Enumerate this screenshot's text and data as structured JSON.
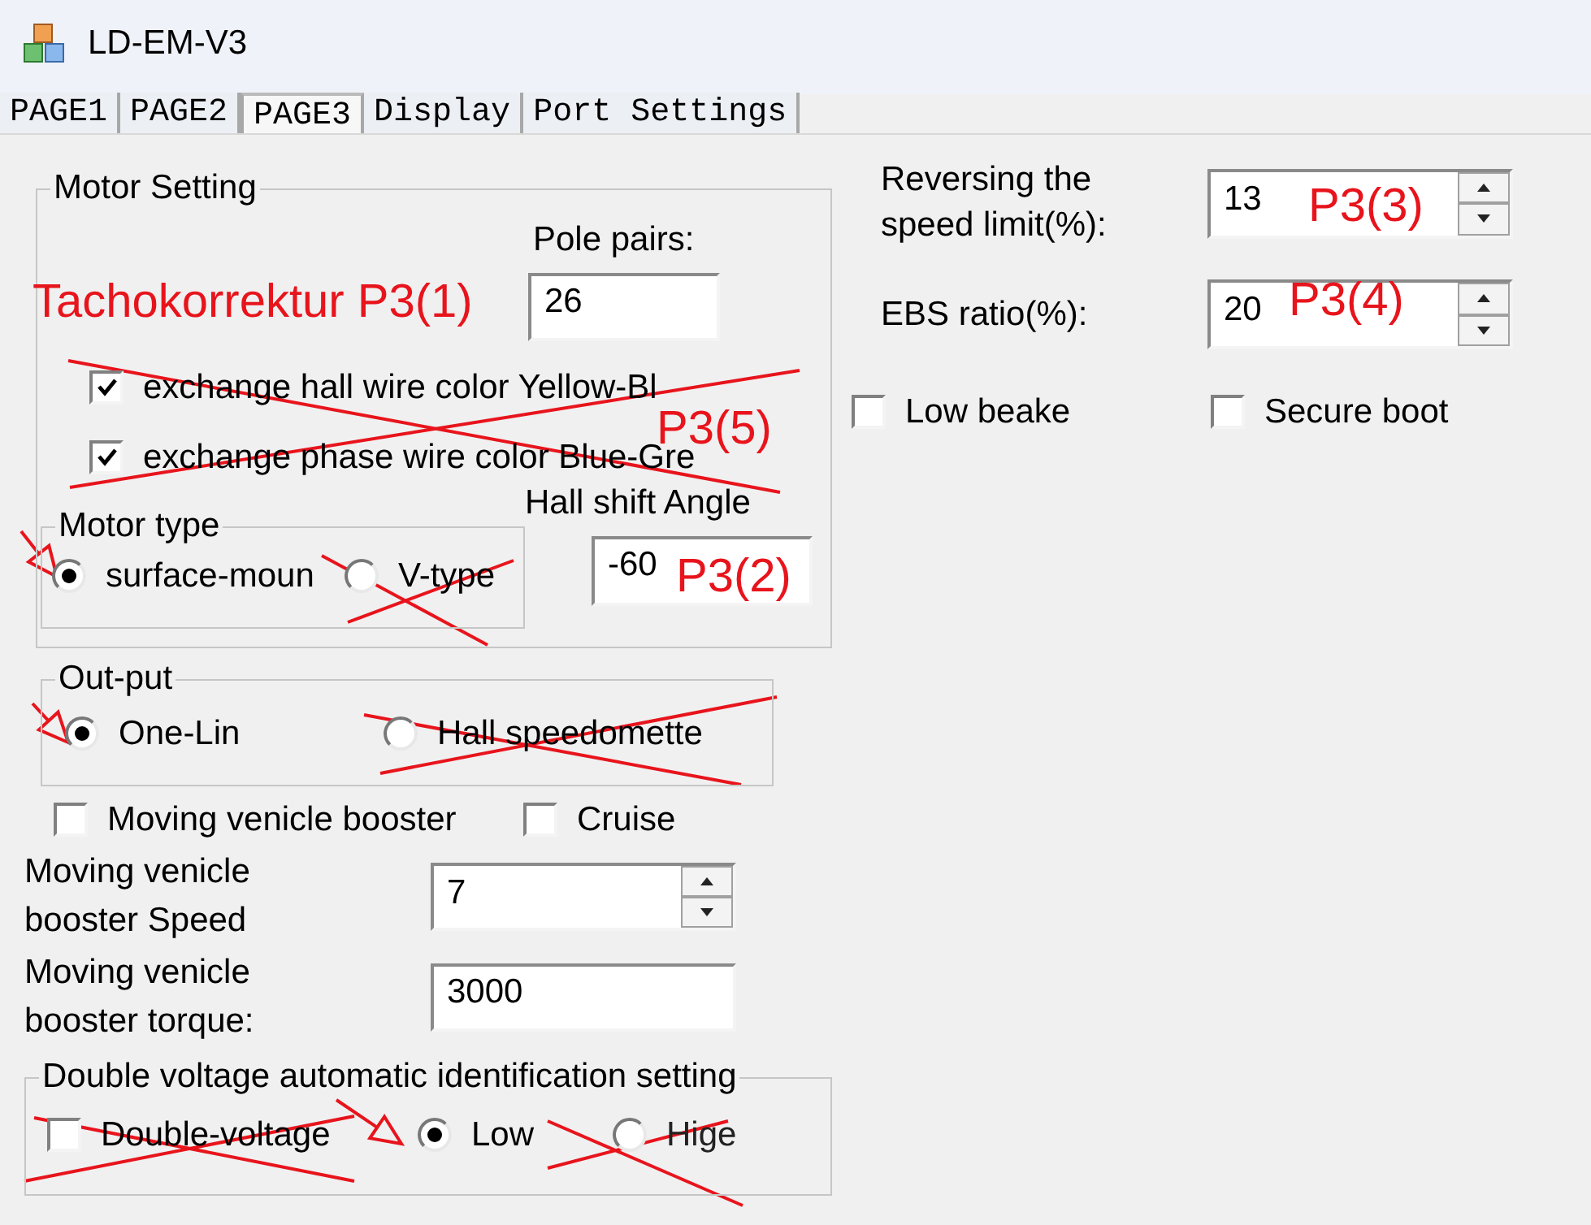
{
  "window": {
    "title": "LD-EM-V3"
  },
  "tabs": [
    {
      "label": "PAGE1",
      "selected": false
    },
    {
      "label": "PAGE2",
      "selected": false
    },
    {
      "label": "PAGE3",
      "selected": true
    },
    {
      "label": "Display",
      "selected": false
    },
    {
      "label": "Port Settings",
      "selected": false
    }
  ],
  "motor_setting": {
    "title": "Motor Setting",
    "pole_pairs": {
      "label": "Pole pairs:",
      "value": "26"
    },
    "options": [
      {
        "label": "exchange hall wire color Yellow-Bl",
        "checked": true
      },
      {
        "label": "exchange phase wire color Blue-Gre",
        "checked": true
      }
    ],
    "hall_shift_angle": {
      "label": "Hall shift Angle",
      "value": "-60"
    },
    "motor_type": {
      "title": "Motor type",
      "options": [
        {
          "label": "surface-moun",
          "selected": true
        },
        {
          "label": "V-type",
          "selected": false
        }
      ]
    }
  },
  "reversing_speed_limit": {
    "label": "Reversing the speed limit(%):",
    "value": "13"
  },
  "ebs_ratio": {
    "label": "EBS ratio(%):",
    "value": "20"
  },
  "toggles": [
    {
      "label": "Low beake",
      "checked": false
    },
    {
      "label": "Secure boot",
      "checked": false
    }
  ],
  "output": {
    "title": "Out-put",
    "options": [
      {
        "label": "One-Lin",
        "selected": true
      },
      {
        "label": "Hall speedomette",
        "selected": false
      }
    ]
  },
  "booster_toggles": [
    {
      "label": "Moving venicle booster",
      "checked": false
    },
    {
      "label": "Cruise",
      "checked": false
    }
  ],
  "booster_speed": {
    "label": "Moving venicle booster Speed",
    "value": "7"
  },
  "booster_torque": {
    "label": "Moving venicle booster torque:",
    "value": "3000"
  },
  "double_voltage": {
    "title": "Double voltage automatic identification setting",
    "checkbox": {
      "label": "Double-voltage",
      "checked": false
    },
    "options": [
      {
        "label": "Low",
        "selected": true
      },
      {
        "label": "Hige",
        "selected": false
      }
    ]
  },
  "annotations": [
    {
      "text": "Tachokorrektur P3(1)"
    },
    {
      "text": "P3(5)"
    },
    {
      "text": "P3(2)"
    },
    {
      "text": "P3(3)"
    },
    {
      "text": "P3(4)"
    }
  ]
}
